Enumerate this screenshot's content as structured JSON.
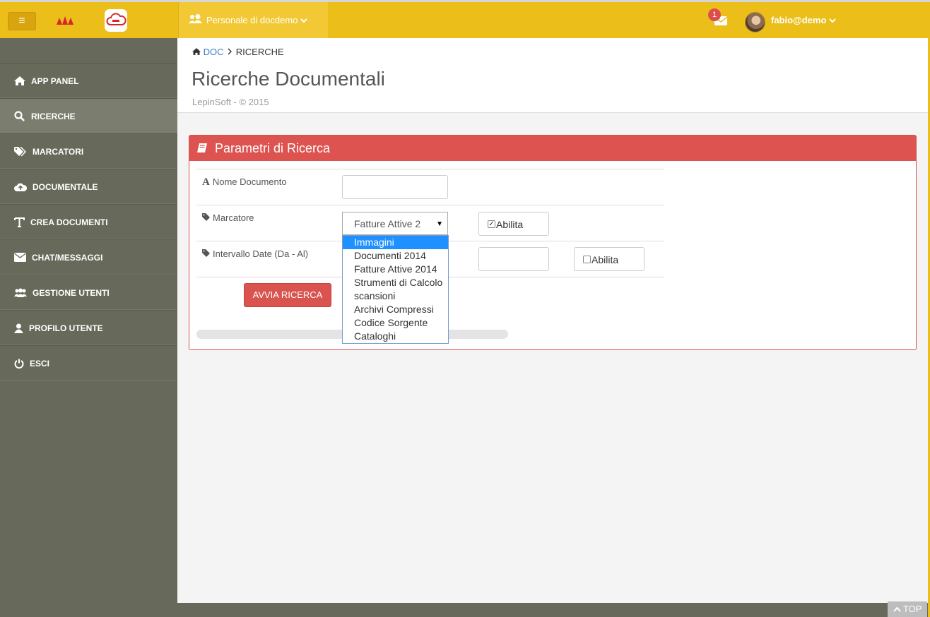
{
  "topbar": {
    "menu_glyph": "≡",
    "company": "Personale di docdemo",
    "mail_badge": "1",
    "user": "fabio@demo"
  },
  "sidebar": {
    "items": [
      {
        "label": "APP PANEL",
        "icon": "home-icon"
      },
      {
        "label": "RICERCHE",
        "icon": "search-icon",
        "active": true
      },
      {
        "label": "MARCATORI",
        "icon": "tags-icon"
      },
      {
        "label": "DOCUMENTALE",
        "icon": "cloud-upload-icon"
      },
      {
        "label": "CREA DOCUMENTI",
        "icon": "text-icon"
      },
      {
        "label": "CHAT/MESSAGGI",
        "icon": "envelope-icon"
      },
      {
        "label": "GESTIONE UTENTI",
        "icon": "users-icon"
      },
      {
        "label": "PROFILO UTENTE",
        "icon": "user-icon"
      },
      {
        "label": "ESCI",
        "icon": "power-icon"
      }
    ]
  },
  "breadcrumb": {
    "root": "DOC",
    "current": "RICERCHE"
  },
  "page": {
    "title": "Ricerche Documentali",
    "subtitle": "LepinSoft - © 2015"
  },
  "panel": {
    "title": "Parametri di Ricerca",
    "rows": [
      {
        "label": "Nome Documento",
        "value": ""
      },
      {
        "label": "Marcatore",
        "selected": "Fatture Attive 2",
        "enable_label": "Abilita",
        "enabled": true
      },
      {
        "label": "Intervallo Date (Da - Al)",
        "enable_label": "Abilita",
        "enabled": false
      }
    ],
    "submit_label": "AVVIA RICERCA"
  },
  "dropdown": {
    "options": [
      "Immagini",
      "Documenti 2014",
      "Fatture Attive 2014",
      "Strumenti di Calcolo",
      "scansioni",
      "Archivi Compressi",
      "Codice Sorgente",
      "Cataloghi"
    ],
    "highlighted": 0
  },
  "scroll_top_label": "TOP",
  "colors": {
    "accent": "#ecbe1a",
    "sidebar": "#676a5a",
    "danger": "#dc534f",
    "highlight": "#1e90ff"
  }
}
